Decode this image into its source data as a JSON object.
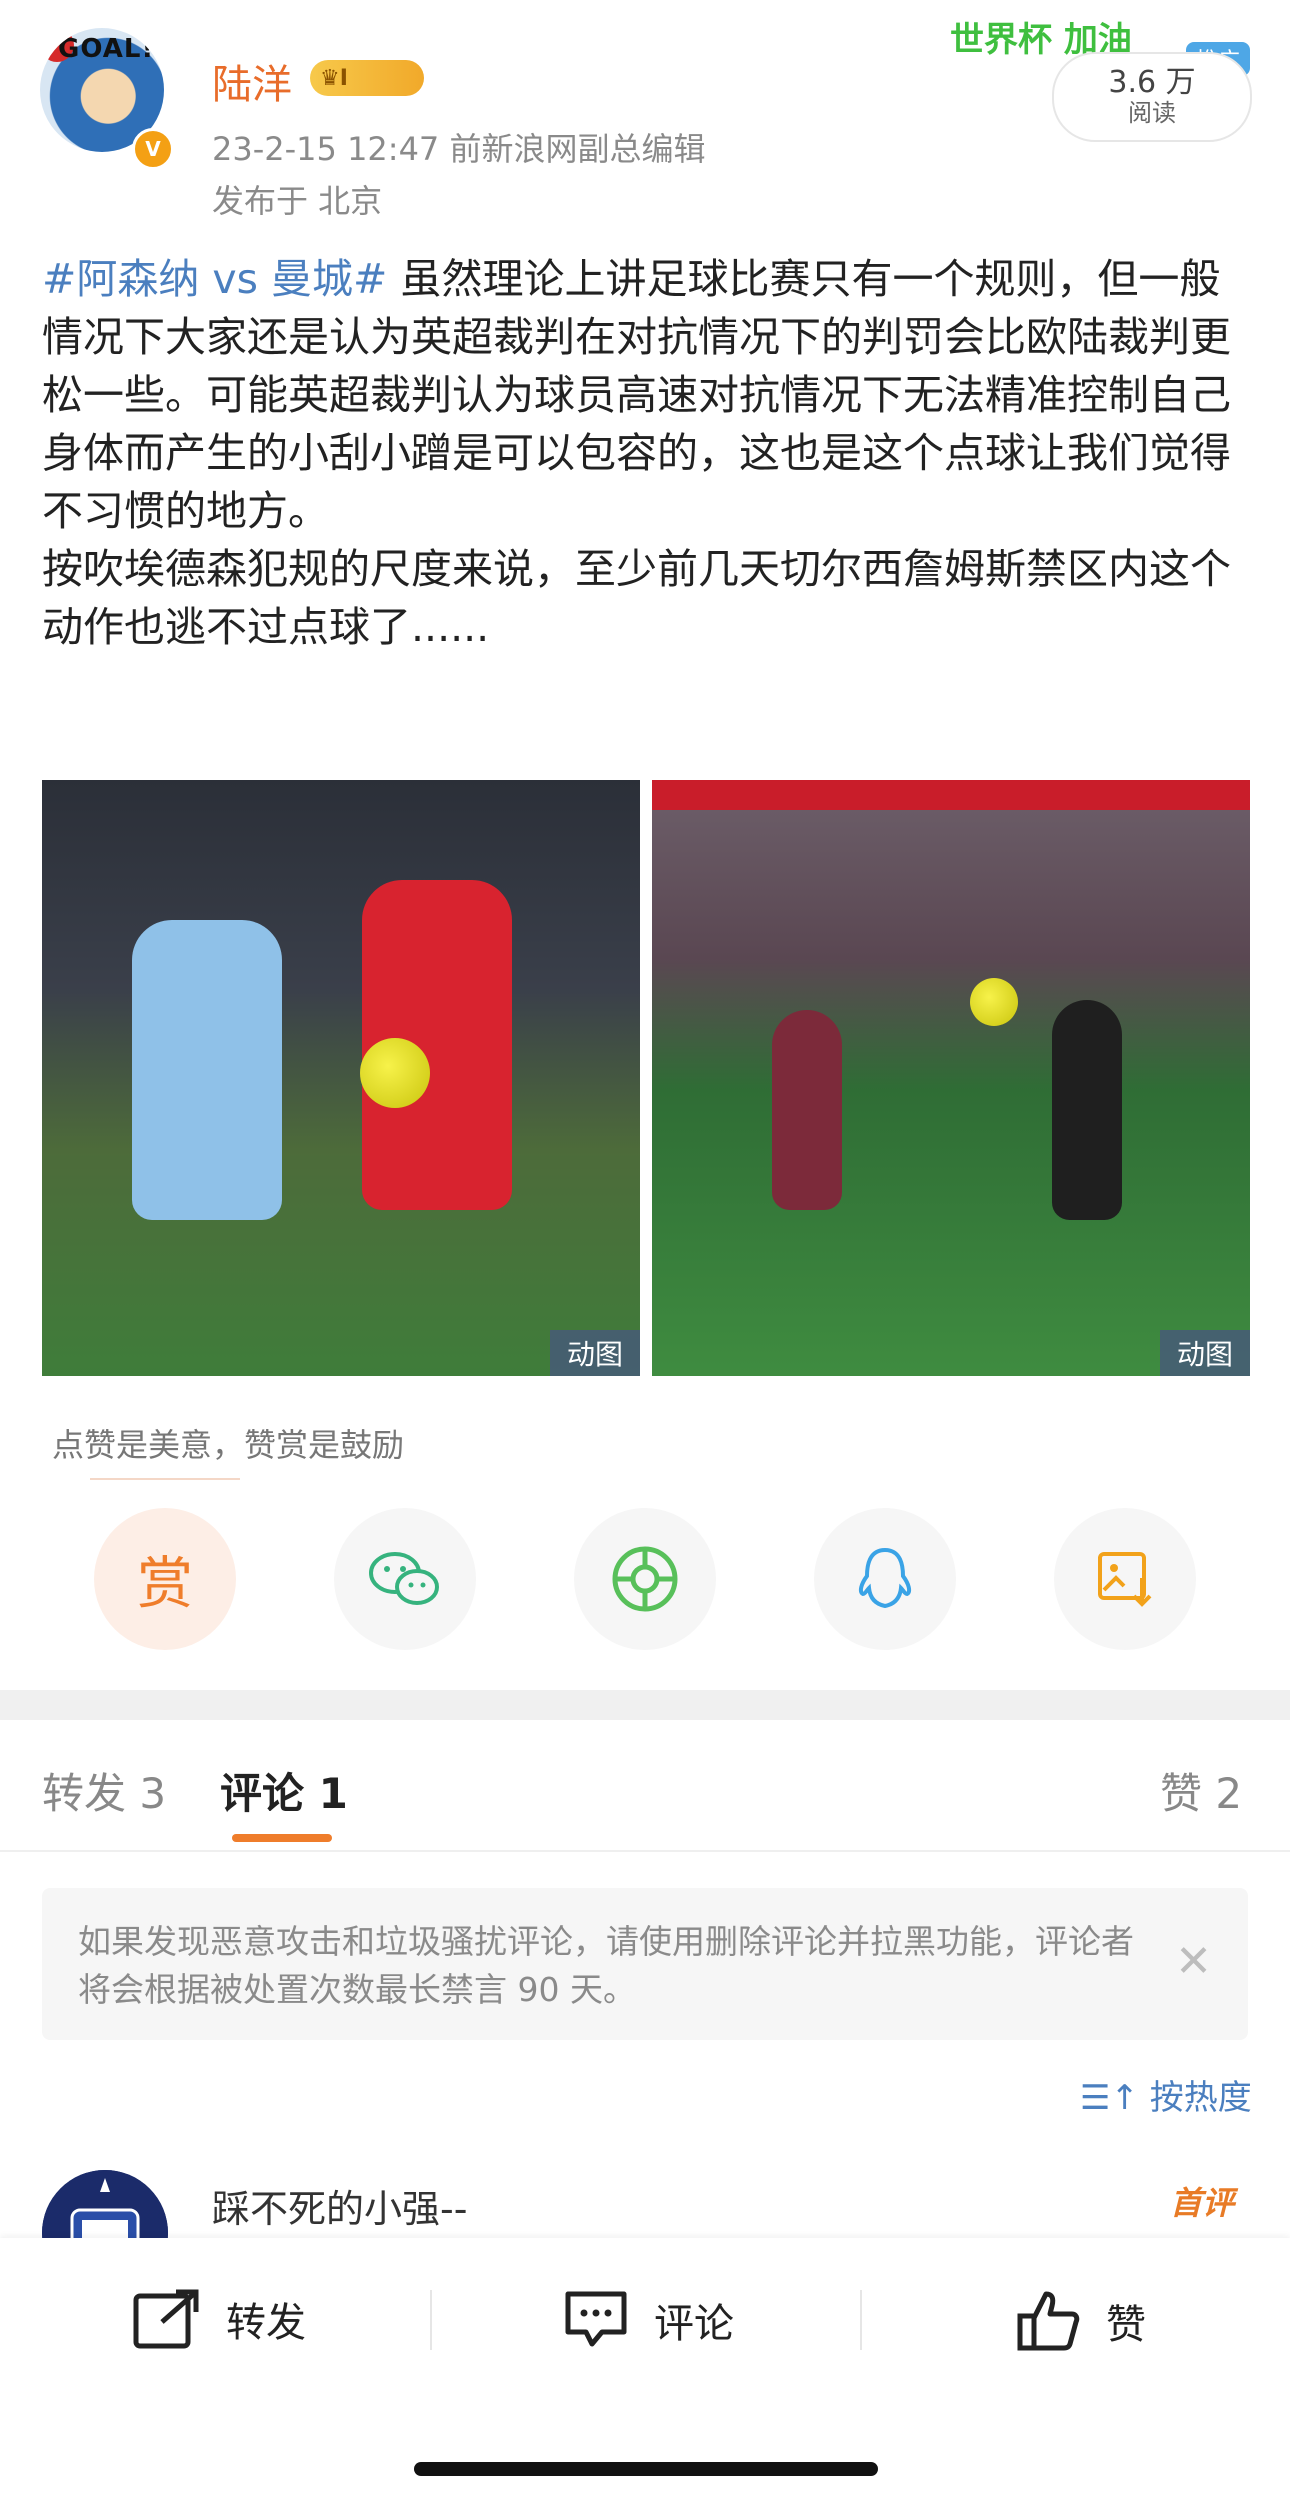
{
  "author": {
    "name": "陆洋",
    "vip_level": "I",
    "date_time": "23-2-15 12:47",
    "title": "前新浪网副总编辑",
    "location": "发布于 北京",
    "avatar_text": "GOAL!"
  },
  "promo": {
    "text": "世界杯 加油",
    "badge": "推广",
    "reads_count": "3.6 万",
    "reads_label": "阅读"
  },
  "post": {
    "topic": "#阿森纳 vs 曼城#",
    "paragraph1": " 虽然理论上讲足球比赛只有一个规则，但一般情况下大家还是认为英超裁判在对抗情况下的判罚会比欧陆裁判更松一些。可能英超裁判认为球员高速对抗情况下无法精准控制自己身体而产生的小刮小蹭是可以包容的，这也是这个点球让我们觉得不习惯的地方。",
    "paragraph2": "按吹埃德森犯规的尺度来说，至少前几天切尔西詹姆斯禁区内这个动作也逃不过点球了......"
  },
  "images": [
    {
      "tag": "动图"
    },
    {
      "tag": "动图"
    }
  ],
  "reward": {
    "hint": "点赞是美意，赞赏是鼓励",
    "reward_glyph": "赏"
  },
  "share_icons": [
    "reward-icon",
    "wechat-icon",
    "moments-icon",
    "qq-icon",
    "save-image-icon"
  ],
  "tabs": {
    "repost": "转发 3",
    "comment": "评论 1",
    "like": "赞 2"
  },
  "notice": {
    "text": "如果发现恶意攻击和垃圾骚扰评论，请使用删除评论并拉黑功能，评论者将会根据被处置次数最长禁言 90 天。"
  },
  "sort": {
    "label": "按热度"
  },
  "comment": {
    "name": "踩不死的小强--",
    "badge": "首评"
  },
  "bottom_bar": {
    "repost": "转发",
    "comment": "评论",
    "like": "赞"
  },
  "colors": {
    "accent_orange": "#ef7d2b",
    "link_blue": "#4b7fbf",
    "username_orange": "#e86c2a"
  }
}
